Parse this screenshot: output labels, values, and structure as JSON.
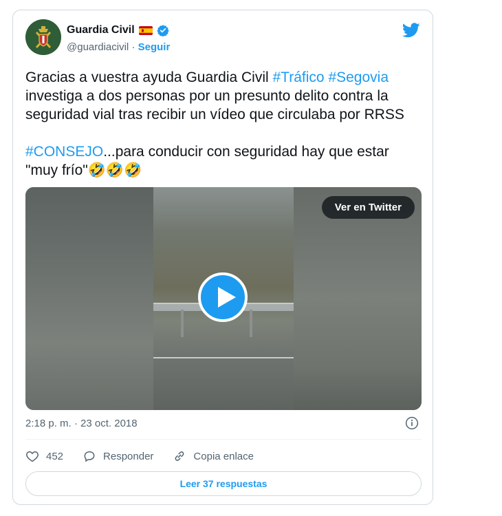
{
  "author": {
    "name": "Guardia Civil",
    "handle": "@guardiacivil",
    "separator": "·",
    "follow_label": "Seguir"
  },
  "tweet": {
    "line1_prefix": "Gracias a vuestra ayuda Guardia Civil ",
    "hashtag_trafico": "#Tráfico",
    "space": " ",
    "hashtag_segovia": "#Segovia",
    "line2": "investiga a dos personas por un presunto delito contra la seguridad vial tras recibir un vídeo que circulaba por RRSS",
    "hashtag_consejo": "#CONSEJO",
    "line3": "...para conducir con seguridad hay que estar \"muy frío\"",
    "emojis": "🤣🤣🤣"
  },
  "media": {
    "view_on_twitter_label": "Ver en Twitter"
  },
  "timestamp": "2:18 p. m. · 23 oct. 2018",
  "actions": {
    "like_count": "452",
    "reply_label": "Responder",
    "copy_link_label": "Copia enlace"
  },
  "read_replies_label": "Leer 37 respuestas",
  "colors": {
    "accent": "#1d9bf0",
    "text": "#0f1419",
    "muted": "#536471",
    "border": "#cfd9de"
  },
  "icons": [
    "guardia-civil-logo",
    "spain-flag-icon",
    "verified-badge-icon",
    "twitter-bird-icon",
    "play-icon",
    "info-icon",
    "heart-icon",
    "reply-icon",
    "link-icon"
  ]
}
